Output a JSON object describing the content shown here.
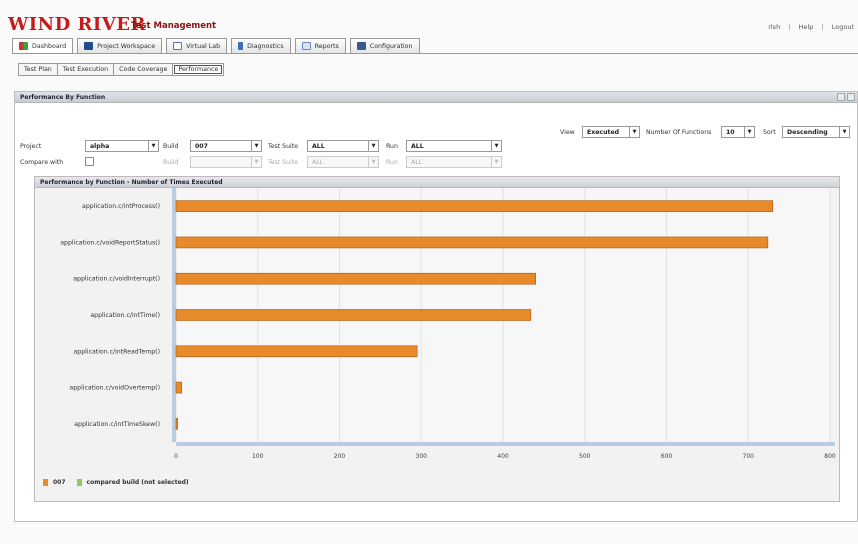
{
  "header": {
    "logo": "WIND RIVER",
    "product": "Test Management",
    "links": [
      "rlsh",
      "Help",
      "Logout"
    ]
  },
  "nav_tabs": [
    {
      "label": "Dashboard",
      "icon": "dashboard-icon",
      "color": "#2e7d32",
      "active": true
    },
    {
      "label": "Project Workspace",
      "icon": "folder-icon",
      "color": "#1f4e8c"
    },
    {
      "label": "Virtual Lab",
      "icon": "monitor-icon",
      "color": "#5577aa"
    },
    {
      "label": "Diagnostics",
      "icon": "diagnostics-icon",
      "color": "#3b6fb6"
    },
    {
      "label": "Reports",
      "icon": "reports-icon",
      "color": "#6688bb"
    },
    {
      "label": "Configuration",
      "icon": "configuration-icon",
      "color": "#3a5a8a"
    }
  ],
  "sub_tabs": [
    {
      "label": "Test Plan"
    },
    {
      "label": "Test Execution"
    },
    {
      "label": "Code Coverage"
    },
    {
      "label": "Performance",
      "active": true
    }
  ],
  "panel": {
    "title": "Performance By Function"
  },
  "options": {
    "view_label": "View",
    "view_value": "Executed",
    "num_functions_label": "Number Of Functions",
    "num_functions_value": "10",
    "sort_label": "Sort",
    "sort_value": "Descending"
  },
  "filters": {
    "project_label": "Project",
    "project_value": "alpha",
    "build_label": "Build",
    "build_value": "007",
    "suite_label": "Test Suite",
    "suite_value": "ALL",
    "run_label": "Run",
    "run_value": "ALL",
    "compare_label": "Compare with",
    "compare_build_label": "Build",
    "compare_build_value": "",
    "compare_suite_label": "Test Suite",
    "compare_suite_value": "ALL",
    "compare_run_label": "Run",
    "compare_run_value": "ALL"
  },
  "chart_data": {
    "type": "bar",
    "orientation": "horizontal",
    "title": "Performance by Function - Number of Times Executed",
    "categories": [
      "application.c/intProcess()",
      "application.c/voidReportStatus()",
      "application.c/voidInterrupt()",
      "application.c/intTime()",
      "application.c/intReadTemp()",
      "application.c/voidOvertemp()",
      "application.c/intTimeSkew()"
    ],
    "series": [
      {
        "name": "007",
        "values": [
          730,
          724,
          440,
          434,
          295,
          7,
          2
        ],
        "color": "#e8892a"
      },
      {
        "name": "compared build (not selected)",
        "values": [],
        "color": "#9bc26a"
      }
    ],
    "xlim": [
      0,
      800
    ],
    "xticks": [
      0,
      100,
      200,
      300,
      400,
      500,
      600,
      700,
      800
    ],
    "grid": true
  }
}
